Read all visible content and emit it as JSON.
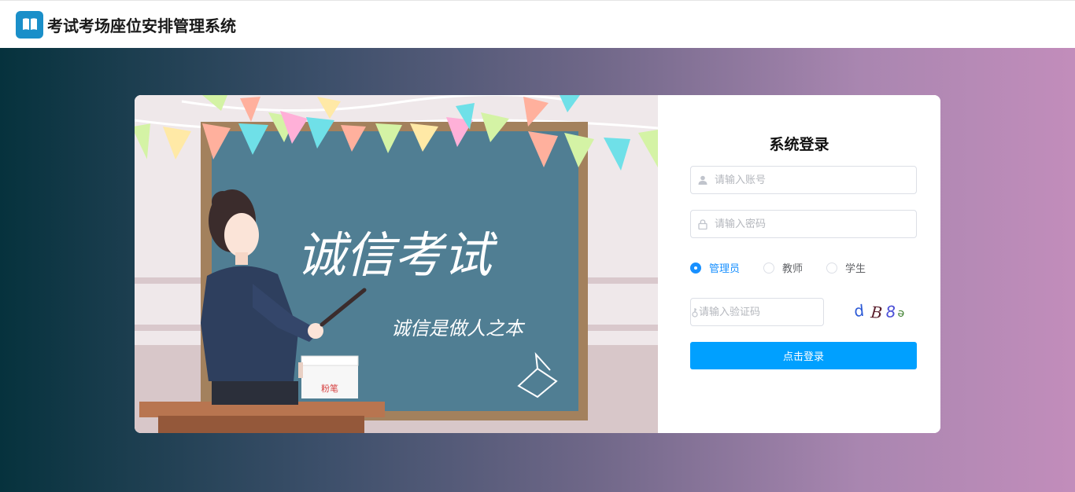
{
  "header": {
    "app_title": "考试考场座位安排管理系统",
    "logo_icon": "book-icon",
    "brand_color": "#1a8fc9"
  },
  "illustration": {
    "board_title": "诚信考试",
    "board_subtitle": "诚信是做人之本",
    "box_label": "粉笔"
  },
  "login": {
    "title": "系统登录",
    "account_placeholder": "请输入账号",
    "password_placeholder": "请输入密码",
    "captcha_placeholder": "请输入验证码",
    "roles": [
      {
        "label": "管理员",
        "selected": true
      },
      {
        "label": "教师",
        "selected": false
      },
      {
        "label": "学生",
        "selected": false
      }
    ],
    "captcha_text": "dB8-",
    "submit_label": "点击登录",
    "accent_color": "#00a0ff"
  }
}
